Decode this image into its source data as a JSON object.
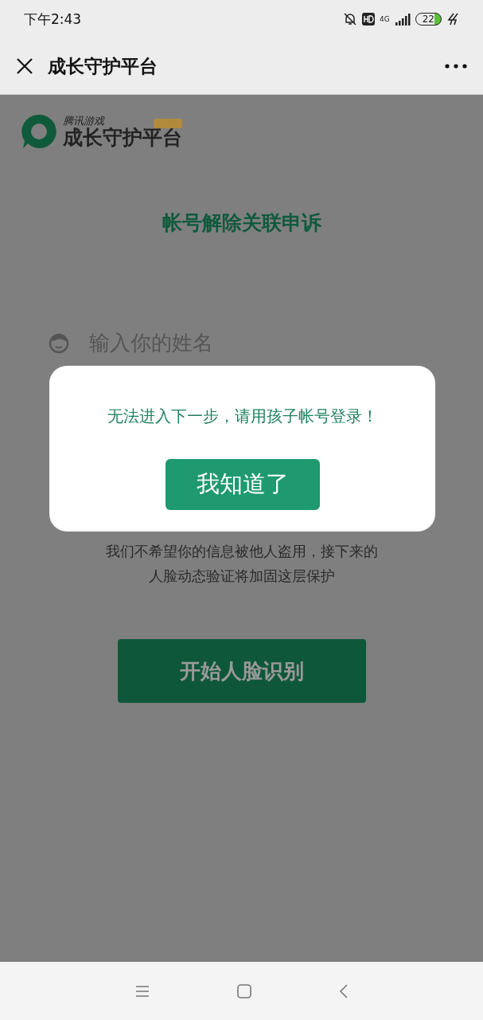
{
  "status_bar": {
    "time": "下午2:43",
    "network": "4G",
    "battery": "22"
  },
  "nav_bar": {
    "title": "成长守护平台"
  },
  "page": {
    "brand_small": "腾讯游戏",
    "brand": "成长守护平台",
    "title": "帐号解除关联申诉",
    "name_field": {
      "placeholder": "输入你的姓名"
    },
    "notice": "我们不希望你的信息被他人盗用，接下来的人脸动态验证将加固这层保护",
    "start_button": "开始人脸识别"
  },
  "dialog": {
    "message": "无法进入下一步，请用孩子帐号登录！",
    "button": "我知道了"
  }
}
